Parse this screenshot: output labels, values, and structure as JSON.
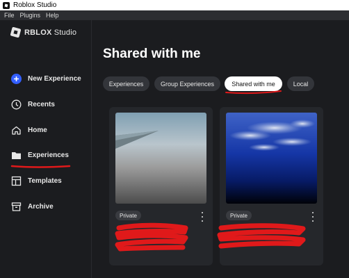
{
  "window": {
    "title": "Roblox Studio"
  },
  "menu": {
    "items": [
      "File",
      "Plugins",
      "Help"
    ]
  },
  "sidebar": {
    "logo_main": "RBLOX",
    "logo_sub": "Studio",
    "items": [
      {
        "label": "New Experience",
        "icon": "plus-circle-icon"
      },
      {
        "label": "Recents",
        "icon": "clock-icon"
      },
      {
        "label": "Home",
        "icon": "home-icon"
      },
      {
        "label": "Experiences",
        "icon": "folder-icon"
      },
      {
        "label": "Templates",
        "icon": "templates-icon"
      },
      {
        "label": "Archive",
        "icon": "archive-icon"
      }
    ]
  },
  "main": {
    "title": "Shared with me",
    "tabs": [
      {
        "label": "Experiences"
      },
      {
        "label": "Group Experiences"
      },
      {
        "label": "Shared with me",
        "active": true
      },
      {
        "label": "Local"
      }
    ],
    "cards": [
      {
        "badge": "Private"
      },
      {
        "badge": "Private"
      }
    ]
  },
  "colors": {
    "accent_blue": "#335fff",
    "annotation_red": "#e0191a"
  }
}
